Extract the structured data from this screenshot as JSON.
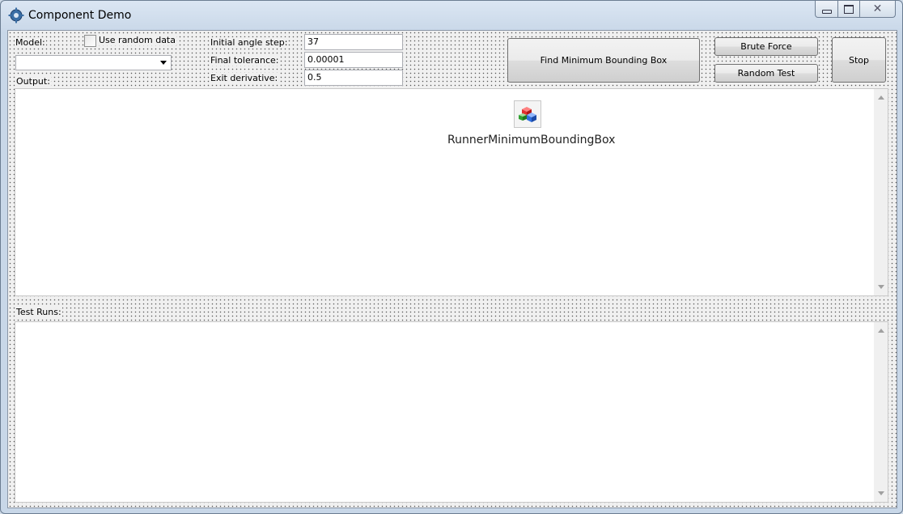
{
  "window": {
    "title": "Component Demo",
    "icon": "app-gear-icon",
    "controls": {
      "minimize": "minimize-icon",
      "maximize": "maximize-icon",
      "close": "close-icon"
    }
  },
  "form": {
    "model_label": "Model:",
    "random_checkbox": {
      "label": "Use random data",
      "checked": false
    },
    "model_combo": {
      "value": ""
    },
    "output_label": "Output:",
    "fields": [
      {
        "label": "Initial angle step:",
        "value": "37"
      },
      {
        "label": "Final tolerance:",
        "value": "0.00001"
      },
      {
        "label": "Exit derivative:",
        "value": "0.5"
      }
    ],
    "buttons": {
      "find": "Find Minimum Bounding Box",
      "brute": "Brute Force",
      "random": "Random Test",
      "stop": "Stop"
    },
    "output_panel": {
      "component_name": "RunnerMinimumBoundingBox",
      "component_icon": "colored-boxes-icon"
    },
    "test_runs_label": "Test Runs:"
  },
  "colors": {
    "panel_bg": "#ffffff",
    "form_bg": "#f0f0f0",
    "title_bar": "#dbe6f3"
  }
}
